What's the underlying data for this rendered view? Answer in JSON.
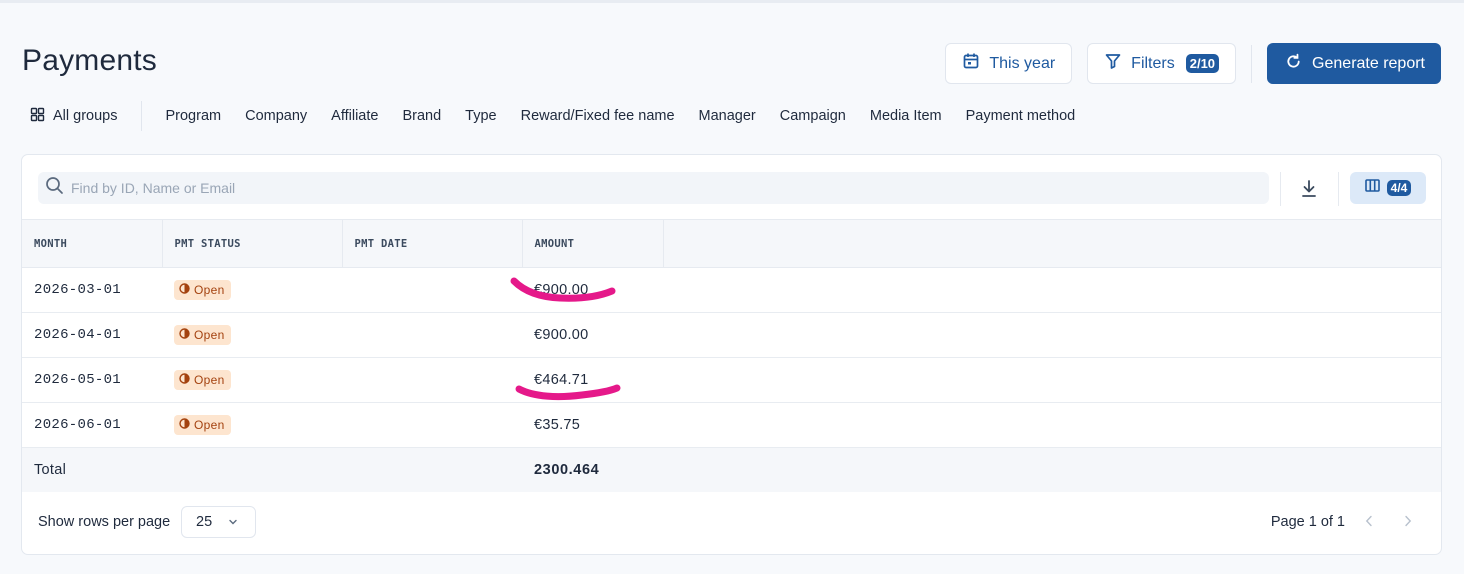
{
  "page": {
    "title": "Payments"
  },
  "header": {
    "date_range_label": "This year",
    "filters_label": "Filters",
    "filters_count": "2/10",
    "generate_label": "Generate report"
  },
  "groups": {
    "all_label": "All groups",
    "items": [
      "Program",
      "Company",
      "Affiliate",
      "Brand",
      "Type",
      "Reward/Fixed fee name",
      "Manager",
      "Campaign",
      "Media Item",
      "Payment method"
    ]
  },
  "search": {
    "placeholder": "Find by ID, Name or Email",
    "value": ""
  },
  "columns_count": "4/4",
  "table": {
    "headers": [
      "MONTH",
      "PMT STATUS",
      "PMT DATE",
      "AMOUNT"
    ],
    "rows": [
      {
        "month": "2026-03-01",
        "status": "Open",
        "date": "",
        "amount": "€900.00"
      },
      {
        "month": "2026-04-01",
        "status": "Open",
        "date": "",
        "amount": "€900.00"
      },
      {
        "month": "2026-05-01",
        "status": "Open",
        "date": "",
        "amount": "€464.71"
      },
      {
        "month": "2026-06-01",
        "status": "Open",
        "date": "",
        "amount": "€35.75"
      }
    ],
    "total": {
      "label": "Total",
      "amount": "2300.464"
    }
  },
  "footer": {
    "rows_label": "Show rows per page",
    "rows_value": "25",
    "page_info": "Page 1 of 1"
  },
  "colors": {
    "accent": "#1f5aa0",
    "status_bg": "#fde5cf",
    "status_text": "#a4420f",
    "annotation": "#e5198a"
  },
  "icons": [
    "calendar-icon",
    "filter-icon",
    "refresh-icon",
    "grid-icon",
    "search-icon",
    "download-icon",
    "columns-icon",
    "status-open-icon",
    "chevron-down-icon",
    "chevron-left-icon",
    "chevron-right-icon"
  ]
}
